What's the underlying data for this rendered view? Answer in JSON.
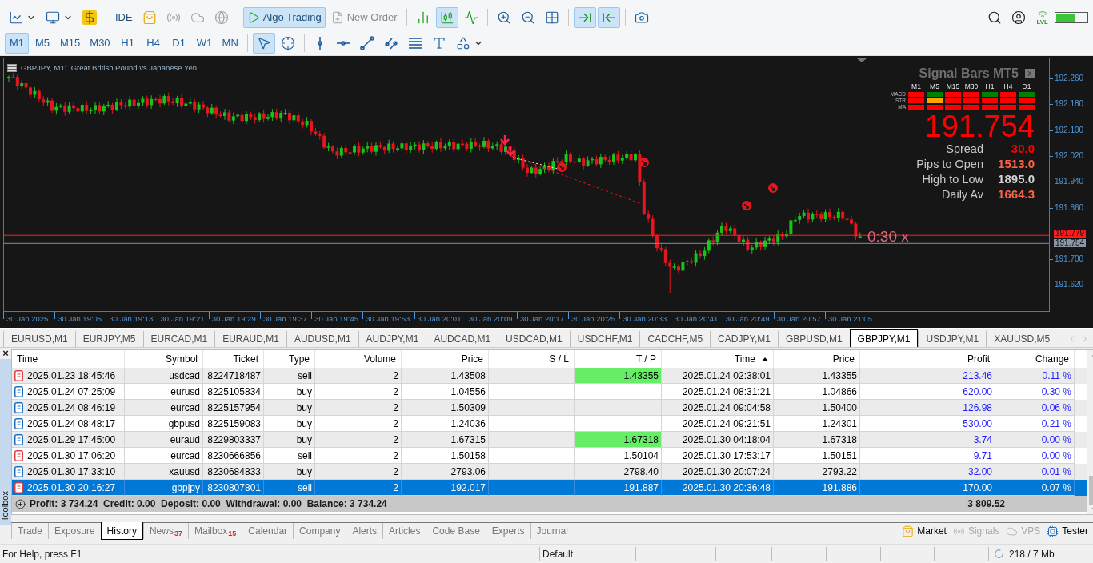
{
  "main_toolbar": [
    {
      "kind": "icon",
      "selected": false,
      "disabled": false
    },
    {
      "kind": "icon",
      "selected": false,
      "disabled": false
    },
    {
      "kind": "icon",
      "selected": false,
      "disabled": false
    },
    {
      "kind": "separator"
    },
    {
      "kind": "text",
      "label": "IDE",
      "selected": false,
      "disabled": false
    },
    {
      "kind": "icon",
      "selected": false,
      "disabled": false
    },
    {
      "kind": "icon",
      "selected": false,
      "disabled": true
    },
    {
      "kind": "icon",
      "selected": false,
      "disabled": true
    },
    {
      "kind": "icon",
      "selected": false,
      "disabled": true
    },
    {
      "kind": "separator"
    },
    {
      "kind": "text",
      "label": "Algo Trading",
      "selected": true,
      "disabled": false
    },
    {
      "kind": "text",
      "label": "New Order",
      "selected": false,
      "disabled": true
    },
    {
      "kind": "separator"
    },
    {
      "kind": "icon",
      "selected": false,
      "disabled": false
    },
    {
      "kind": "icon",
      "selected": true,
      "disabled": false
    },
    {
      "kind": "icon",
      "selected": false,
      "disabled": false
    },
    {
      "kind": "separator"
    },
    {
      "kind": "icon",
      "selected": false,
      "disabled": false
    },
    {
      "kind": "icon",
      "selected": false,
      "disabled": false
    },
    {
      "kind": "icon",
      "selected": false,
      "disabled": false
    },
    {
      "kind": "separator"
    },
    {
      "kind": "icon",
      "selected": true,
      "disabled": false
    },
    {
      "kind": "icon",
      "selected": true,
      "disabled": false
    },
    {
      "kind": "separator"
    },
    {
      "kind": "icon",
      "selected": false,
      "disabled": false
    }
  ],
  "connection_label": "LVL",
  "timeframes": [
    {
      "label": "M1",
      "selected": true
    },
    {
      "label": "M5",
      "selected": false
    },
    {
      "label": "M15",
      "selected": false
    },
    {
      "label": "M30",
      "selected": false
    },
    {
      "label": "H1",
      "selected": false
    },
    {
      "label": "H4",
      "selected": false
    },
    {
      "label": "D1",
      "selected": false
    },
    {
      "label": "W1",
      "selected": false
    },
    {
      "label": "MN",
      "selected": false
    }
  ],
  "drawing_tools": [
    {
      "selected": true
    },
    {
      "selected": false
    },
    {
      "selected": false
    },
    {
      "selected": false
    },
    {
      "selected": false
    },
    {
      "selected": false
    },
    {
      "selected": false
    },
    {
      "selected": false
    },
    {
      "selected": false
    }
  ],
  "chart": {
    "title": "GBPJPY, M1:  Great British Pound vs Japanese Yen",
    "price_labels": [
      "192.260",
      "192.180",
      "192.100",
      "192.020",
      "191.940",
      "191.860",
      "191.700",
      "191.620"
    ],
    "ask_tag": "191.779",
    "bid_tag": "191.754",
    "countdown": "0:30 x",
    "time_labels": [
      "30 Jan 2025",
      "30 Jan 19:05",
      "30 Jan 19:13",
      "30 Jan 19:21",
      "30 Jan 19:29",
      "30 Jan 19:37",
      "30 Jan 19:45",
      "30 Jan 19:53",
      "30 Jan 20:01",
      "30 Jan 20:09",
      "30 Jan 20:17",
      "30 Jan 20:25",
      "30 Jan 20:33",
      "30 Jan 20:41",
      "30 Jan 20:49",
      "30 Jan 20:57",
      "30 Jan 21:05"
    ],
    "signal_panel": {
      "title": "Signal Bars MT5",
      "close": "x",
      "timeframes": [
        "M1",
        "M5",
        "M15",
        "M30",
        "H1",
        "H4",
        "D1"
      ],
      "rows": [
        {
          "label": "MACD",
          "cells": [
            {
              "color": "#ff0000"
            },
            {
              "color": "#008000"
            },
            {
              "color": "#ff0000"
            },
            {
              "color": "#ff0000"
            },
            {
              "color": "#008000"
            },
            {
              "color": "#ff0000"
            },
            {
              "color": "#008000"
            }
          ]
        },
        {
          "label": "STR",
          "cells": [
            {
              "color": "#ff0000"
            },
            {
              "color": "#ffa500"
            },
            {
              "color": "#ff0000"
            },
            {
              "color": "#ff0000"
            },
            {
              "color": "#ff0000"
            },
            {
              "color": "#ff0000"
            },
            {
              "color": "#ff0000"
            }
          ]
        },
        {
          "label": "MA",
          "cells": [
            {
              "color": "#ff0000"
            },
            {
              "color": "#ff0000"
            },
            {
              "color": "#ff0000"
            },
            {
              "color": "#ff0000"
            },
            {
              "color": "#ff0000"
            },
            {
              "color": "#ff0000"
            },
            {
              "color": "#ff0000"
            }
          ]
        }
      ],
      "price": "191.754",
      "stats": [
        {
          "label": "Spread",
          "value": "30.0",
          "color": "#ff0000"
        },
        {
          "label": "Pips to Open",
          "value": "1513.0",
          "color": "#ff6347"
        },
        {
          "label": "High to Low",
          "value": "1895.0",
          "color": "#d3d3d3"
        },
        {
          "label": "Daily Av",
          "value": "1664.3",
          "color": "#ff6347"
        }
      ]
    }
  },
  "symbol_tabs": [
    {
      "label": "EURUSD,M1",
      "selected": false
    },
    {
      "label": "EURJPY,M5",
      "selected": false
    },
    {
      "label": "EURCAD,M1",
      "selected": false
    },
    {
      "label": "EURAUD,M1",
      "selected": false
    },
    {
      "label": "AUDUSD,M1",
      "selected": false
    },
    {
      "label": "AUDJPY,M1",
      "selected": false
    },
    {
      "label": "AUDCAD,M1",
      "selected": false
    },
    {
      "label": "USDCAD,M1",
      "selected": false
    },
    {
      "label": "USDCHF,M1",
      "selected": false
    },
    {
      "label": "CADCHF,M5",
      "selected": false
    },
    {
      "label": "CADJPY,M1",
      "selected": false
    },
    {
      "label": "GBPUSD,M1",
      "selected": false
    },
    {
      "label": "GBPJPY,M1",
      "selected": true
    },
    {
      "label": "USDJPY,M1",
      "selected": false
    },
    {
      "label": "XAUUSD,M5",
      "selected": false
    }
  ],
  "toolbox": {
    "label": "Toolbox",
    "close": "×",
    "table": {
      "columns": [
        {
          "label": "Time",
          "sorted": false
        },
        {
          "label": "Symbol",
          "sorted": false
        },
        {
          "label": "Ticket",
          "sorted": false
        },
        {
          "label": "Type",
          "sorted": false
        },
        {
          "label": "Volume",
          "sorted": false
        },
        {
          "label": "Price",
          "sorted": false
        },
        {
          "label": "S / L",
          "sorted": false
        },
        {
          "label": "T / P",
          "sorted": false
        },
        {
          "label": "Time",
          "sorted": true
        },
        {
          "label": "Price",
          "sorted": false
        },
        {
          "label": "Profit",
          "sorted": false
        },
        {
          "label": "Change",
          "sorted": false
        }
      ],
      "rows": [
        {
          "kind": "sell",
          "selected": false,
          "tp_hit": true,
          "time": "2025.01.23 18:45:46",
          "symbol": "usdcad",
          "ticket": "8224718487",
          "type": "sell",
          "volume": "2",
          "price": "1.43508",
          "tp": "1.43355",
          "close_time": "2025.01.24 02:38:01",
          "close_price": "1.43355",
          "profit": "213.46",
          "change": "0.11 %"
        },
        {
          "kind": "buy",
          "selected": false,
          "tp_hit": false,
          "time": "2025.01.24 07:25:09",
          "symbol": "eurusd",
          "ticket": "8225105834",
          "type": "buy",
          "volume": "2",
          "price": "1.04556",
          "close_time": "2025.01.24 08:31:21",
          "close_price": "1.04866",
          "profit": "620.00",
          "change": "0.30 %"
        },
        {
          "kind": "buy",
          "selected": false,
          "tp_hit": false,
          "time": "2025.01.24 08:46:19",
          "symbol": "eurcad",
          "ticket": "8225157954",
          "type": "buy",
          "volume": "2",
          "price": "1.50309",
          "close_time": "2025.01.24 09:04:58",
          "close_price": "1.50400",
          "profit": "126.98",
          "change": "0.06 %"
        },
        {
          "kind": "buy",
          "selected": false,
          "tp_hit": false,
          "time": "2025.01.24 08:48:17",
          "symbol": "gbpusd",
          "ticket": "8225159083",
          "type": "buy",
          "volume": "2",
          "price": "1.24036",
          "close_time": "2025.01.24 09:21:51",
          "close_price": "1.24301",
          "profit": "530.00",
          "change": "0.21 %"
        },
        {
          "kind": "buy",
          "selected": false,
          "tp_hit": true,
          "time": "2025.01.29 17:45:00",
          "symbol": "euraud",
          "ticket": "8229803337",
          "type": "buy",
          "volume": "2",
          "price": "1.67315",
          "tp": "1.67318",
          "close_time": "2025.01.30 04:18:04",
          "close_price": "1.67318",
          "profit": "3.74",
          "change": "0.00 %"
        },
        {
          "kind": "sell",
          "selected": false,
          "tp_hit": false,
          "time": "2025.01.30 17:06:20",
          "symbol": "eurcad",
          "ticket": "8230666856",
          "type": "sell",
          "volume": "2",
          "price": "1.50158",
          "tp": "1.50104",
          "close_time": "2025.01.30 17:53:17",
          "close_price": "1.50151",
          "profit": "9.71",
          "change": "0.00 %"
        },
        {
          "kind": "buy",
          "selected": false,
          "tp_hit": false,
          "time": "2025.01.30 17:33:10",
          "symbol": "xauusd",
          "ticket": "8230684833",
          "type": "buy",
          "volume": "2",
          "price": "2793.06",
          "tp": "2798.40",
          "close_time": "2025.01.30 20:07:24",
          "close_price": "2793.22",
          "profit": "32.00",
          "change": "0.01 %"
        },
        {
          "kind": "sell",
          "selected": true,
          "tp_hit": false,
          "time": "2025.01.30 20:16:27",
          "symbol": "gbpjpy",
          "ticket": "8230807801",
          "type": "sell",
          "volume": "2",
          "price": "192.017",
          "tp": "191.887",
          "close_time": "2025.01.30 20:36:48",
          "close_price": "191.886",
          "profit": "170.00",
          "change": "0.07 %"
        }
      ],
      "summary": "Profit: 3 734.24  Credit: 0.00  Deposit: 0.00  Withdrawal: 0.00  Balance: 3 734.24",
      "total": "3 809.52"
    },
    "tabs": [
      {
        "label": "Trade",
        "selected": false
      },
      {
        "label": "Exposure",
        "selected": false
      },
      {
        "label": "History",
        "selected": true
      },
      {
        "label": "News",
        "selected": false,
        "badge": "37"
      },
      {
        "label": "Mailbox",
        "selected": false,
        "badge": "15"
      },
      {
        "label": "Calendar",
        "selected": false
      },
      {
        "label": "Company",
        "selected": false
      },
      {
        "label": "Alerts",
        "selected": false
      },
      {
        "label": "Articles",
        "selected": false
      },
      {
        "label": "Code Base",
        "selected": false
      },
      {
        "label": "Experts",
        "selected": false
      },
      {
        "label": "Journal",
        "selected": false
      }
    ],
    "services": [
      {
        "label": "Market",
        "disabled": false
      },
      {
        "label": "Signals",
        "disabled": true
      },
      {
        "label": "VPS",
        "disabled": true
      },
      {
        "label": "Tester",
        "disabled": false
      }
    ]
  },
  "status_bar": {
    "help": "For Help, press F1",
    "profile": "Default",
    "memory": "218 / 7 Mb"
  }
}
